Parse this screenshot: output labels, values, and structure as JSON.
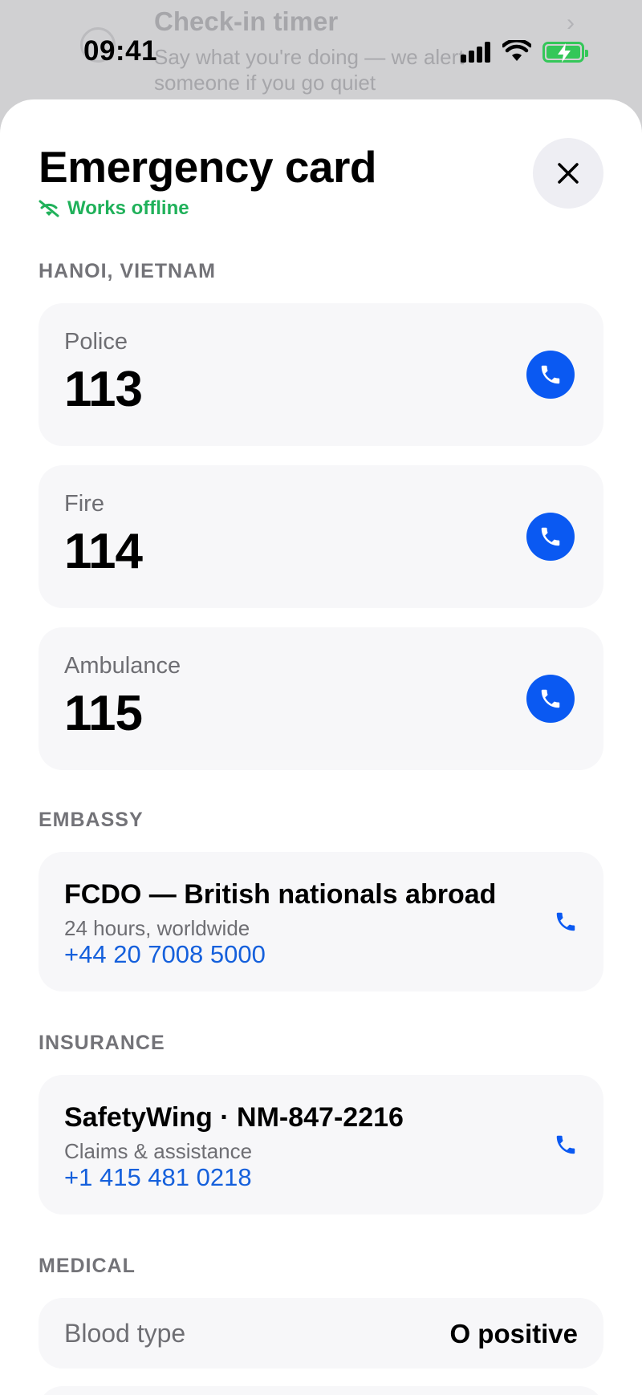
{
  "background": {
    "row_title": "Check-in timer",
    "row_subtitle": "Say what you're doing — we alert someone if you go quiet"
  },
  "status_bar": {
    "time": "09:41"
  },
  "sheet": {
    "title": "Emergency card",
    "offline_badge": "Works offline",
    "colors": {
      "accent": "#0a59f2",
      "offline": "#20b15a",
      "link": "#1560dc"
    }
  },
  "location": {
    "heading": "HANOI, VIETNAM",
    "services": [
      {
        "label": "Police",
        "number": "113"
      },
      {
        "label": "Fire",
        "number": "114"
      },
      {
        "label": "Ambulance",
        "number": "115"
      }
    ]
  },
  "embassy": {
    "heading": "EMBASSY",
    "title": "FCDO — British nationals abroad",
    "subtitle": "24 hours, worldwide",
    "phone": "+44 20 7008 5000"
  },
  "insurance": {
    "heading": "INSURANCE",
    "title": "SafetyWing · NM-847-2216",
    "subtitle": "Claims & assistance",
    "phone": "+1 415 481 0218"
  },
  "medical": {
    "heading": "MEDICAL",
    "items": [
      {
        "label": "Blood type",
        "value": "O positive"
      }
    ]
  }
}
